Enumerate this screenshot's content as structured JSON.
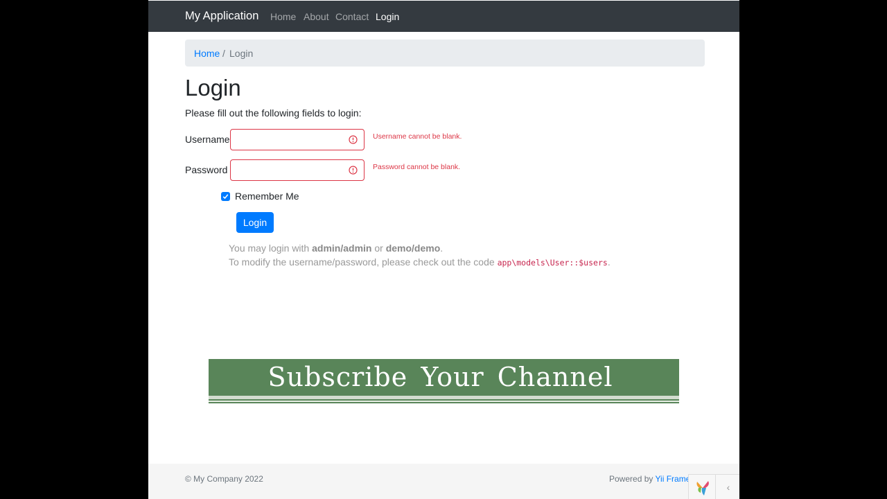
{
  "navbar": {
    "brand": "My Application",
    "links": [
      {
        "label": "Home"
      },
      {
        "label": "About"
      },
      {
        "label": "Contact"
      },
      {
        "label": "Login",
        "active": true
      }
    ]
  },
  "breadcrumb": {
    "home": "Home",
    "separator": "/",
    "current": "Login"
  },
  "page": {
    "title": "Login",
    "intro": "Please fill out the following fields to login:"
  },
  "form": {
    "username": {
      "label": "Username",
      "value": "",
      "error": "Username cannot be blank."
    },
    "password": {
      "label": "Password",
      "value": "",
      "error": "Password cannot be blank."
    },
    "remember": {
      "label": "Remember Me",
      "checked": true
    },
    "submit_label": "Login"
  },
  "hint": {
    "line1_prefix": "You may login with ",
    "cred1": "admin/admin",
    "or": " or ",
    "cred2": "demo/demo",
    "line1_suffix": ".",
    "line2_prefix": "To modify the username/password, please check out the code ",
    "code": "app\\models\\User::$users",
    "line2_suffix": "."
  },
  "banner": {
    "text": "Subscribe Your Channel"
  },
  "footer": {
    "copyright": "© My Company 2022",
    "powered_prefix": "Powered by ",
    "powered_link": "Yii Frame"
  },
  "colors": {
    "navbar_bg": "#343a40",
    "primary": "#007bff",
    "error": "#dc3545",
    "banner_bg": "#598559"
  }
}
